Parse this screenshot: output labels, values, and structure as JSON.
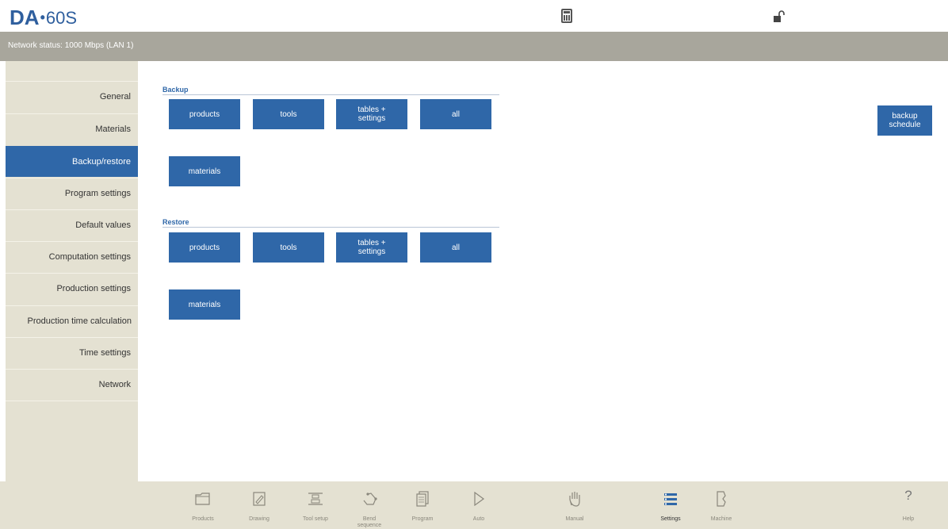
{
  "header": {
    "logo_brand": "DA",
    "logo_dot": "•",
    "logo_model": "60S",
    "status_text": "Network status: 1000 Mbps (LAN 1)"
  },
  "sidebar": {
    "items": [
      {
        "label": "General"
      },
      {
        "label": "Materials"
      },
      {
        "label": "Backup/restore",
        "active": true
      },
      {
        "label": "Program settings"
      },
      {
        "label": "Default values"
      },
      {
        "label": "Computation settings"
      },
      {
        "label": "Production settings"
      },
      {
        "label": "Production time calculation"
      },
      {
        "label": "Time settings"
      },
      {
        "label": "Network"
      }
    ]
  },
  "backup": {
    "title": "Backup",
    "products": "products",
    "tools": "tools",
    "tables_settings": "tables +\nsettings",
    "all": "all",
    "materials": "materials",
    "schedule": "backup\nschedule"
  },
  "restore": {
    "title": "Restore",
    "products": "products",
    "tools": "tools",
    "tables_settings": "tables +\nsettings",
    "all": "all",
    "materials": "materials"
  },
  "bottom_nav": {
    "products": "Products",
    "drawing": "Drawing",
    "tool_setup": "Tool setup",
    "bend_sequence": "Bend\nsequence",
    "program": "Program",
    "auto": "Auto",
    "manual": "Manual",
    "settings": "Settings",
    "machine": "Machine",
    "help": "Help",
    "help_glyph": "?",
    "active": "settings"
  },
  "colors": {
    "accent": "#2f67a8",
    "statusbar": "#a8a69c",
    "panel": "#e4e1d2"
  }
}
